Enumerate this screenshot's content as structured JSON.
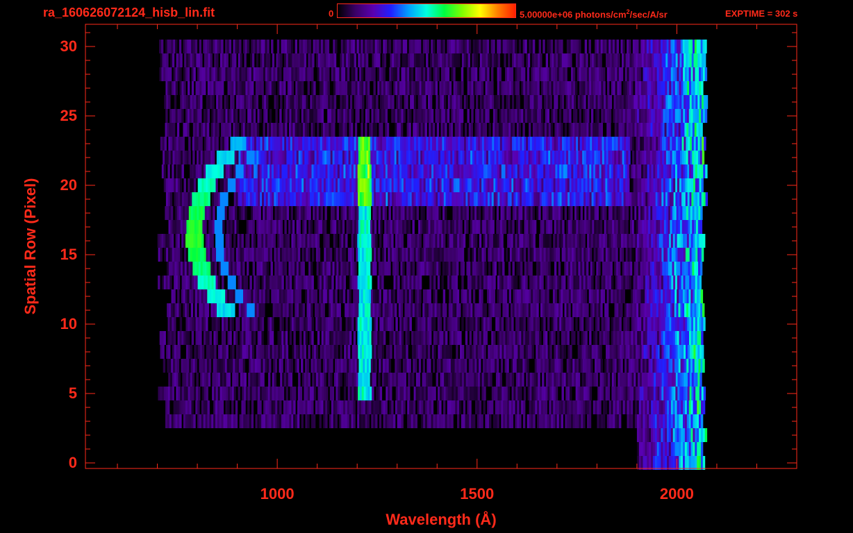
{
  "header": {
    "filename": "ra_160626072124_hisb_lin.fit",
    "colorbar_min_label": "0",
    "colorbar_max_value": "5.00000e+06",
    "colorbar_units_pre": "photons/cm",
    "colorbar_units_sup": "2",
    "colorbar_units_post": "/sec/A/sr",
    "exptime": "EXPTIME = 302 s"
  },
  "colors": {
    "axis_text": "#ff2a1a",
    "background": "#000000",
    "colormap": [
      "#000000",
      "#3a0066",
      "#5a00b0",
      "#2020ff",
      "#00a0ff",
      "#00ffe0",
      "#00ff40",
      "#80ff00",
      "#ffff00",
      "#ff8000",
      "#ff2000"
    ]
  },
  "chart_data": {
    "type": "heatmap",
    "title": "ra_160626072124_hisb_lin.fit",
    "xlabel": "Wavelength (Å)",
    "ylabel": "Spatial Row (Pixel)",
    "xlim": [
      520,
      2300
    ],
    "ylim": [
      -0.4,
      31.6
    ],
    "xticks": [
      1000,
      1500,
      2000
    ],
    "yticks": [
      0,
      5,
      10,
      15,
      20,
      25,
      30
    ],
    "colorbar": {
      "min": 0,
      "max": 5000000,
      "units": "photons/cm^2/sec/A/sr"
    },
    "grid": false,
    "features": [
      {
        "name": "Lyman-alpha band",
        "wavelength": 1216,
        "rows": [
          5,
          23
        ],
        "peak_intensity_fraction": 0.55
      },
      {
        "name": "Arc",
        "wavelength_range": [
          780,
          940
        ],
        "rows": [
          11,
          23
        ],
        "peak_intensity_fraction": 0.6
      },
      {
        "name": "Red-edge continuum",
        "wavelength_range": [
          1900,
          2070
        ],
        "rows": [
          2,
          30
        ],
        "peak_intensity_fraction": 0.5
      }
    ]
  }
}
